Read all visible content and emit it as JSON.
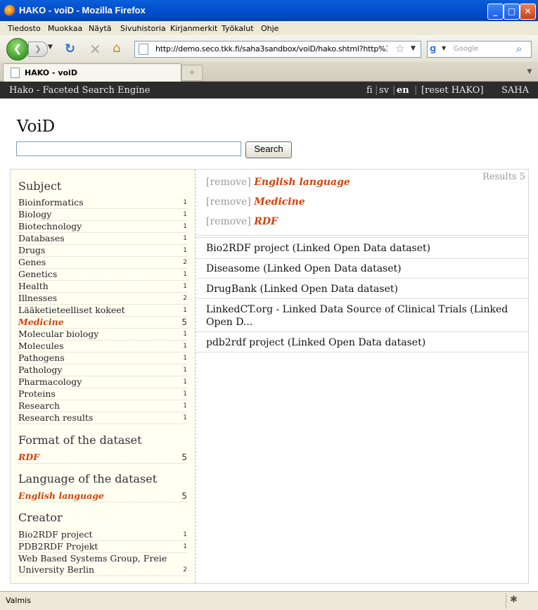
{
  "window": {
    "title": "HAKO - voiD - Mozilla Firefox"
  },
  "menu": [
    "Tiedosto",
    "Muokkaa",
    "Näytä",
    "Sivuhistoria",
    "Kirjanmerkit",
    "Työkalut",
    "Ohje"
  ],
  "nav": {
    "url": "http://demo.seco.tkk.fi/saha3sandbox/voiD/hako.shtml?http%3A%2",
    "search_placeholder": "Google"
  },
  "tab": {
    "label": "HAKO - voiD"
  },
  "app": {
    "brand": "Hako - Faceted Search Engine",
    "lang_fi": "fi",
    "lang_sv": "sv",
    "lang_en": "en",
    "reset": "[reset HAKO]",
    "saha": "SAHA"
  },
  "page": {
    "title": "VoiD",
    "search_button": "Search",
    "search_value": ""
  },
  "facets": {
    "subject": {
      "heading": "Subject",
      "items": [
        {
          "label": "Bioinformatics",
          "count": "1"
        },
        {
          "label": "Biology",
          "count": "1"
        },
        {
          "label": "Biotechnology",
          "count": "1"
        },
        {
          "label": "Databases",
          "count": "1"
        },
        {
          "label": "Drugs",
          "count": "1"
        },
        {
          "label": "Genes",
          "count": "2"
        },
        {
          "label": "Genetics",
          "count": "1"
        },
        {
          "label": "Health",
          "count": "1"
        },
        {
          "label": "Illnesses",
          "count": "2"
        },
        {
          "label": "Lääketieteelliset kokeet",
          "count": "1"
        },
        {
          "label": "Medicine",
          "count": "5"
        },
        {
          "label": "Molecular biology",
          "count": "1"
        },
        {
          "label": "Molecules",
          "count": "1"
        },
        {
          "label": "Pathogens",
          "count": "1"
        },
        {
          "label": "Pathology",
          "count": "1"
        },
        {
          "label": "Pharmacology",
          "count": "1"
        },
        {
          "label": "Proteins",
          "count": "1"
        },
        {
          "label": "Research",
          "count": "1"
        },
        {
          "label": "Research results",
          "count": "1"
        }
      ]
    },
    "format": {
      "heading": "Format of the dataset",
      "items": [
        {
          "label": "RDF",
          "count": "5"
        }
      ]
    },
    "language": {
      "heading": "Language of the dataset",
      "items": [
        {
          "label": "English language",
          "count": "5"
        }
      ]
    },
    "creator": {
      "heading": "Creator",
      "items": [
        {
          "label": "Bio2RDF project",
          "count": "1"
        },
        {
          "label": "PDB2RDF Projekt",
          "count": "1"
        },
        {
          "label": "Web Based Systems Group, Freie University Berlin",
          "count": "2"
        }
      ]
    }
  },
  "results": {
    "count_label": "Results 5",
    "remove_label": "[remove]",
    "active_filters": [
      "English language",
      "Medicine",
      "RDF"
    ],
    "items": [
      "Bio2RDF project (Linked Open Data dataset)",
      "Diseasome (Linked Open Data dataset)",
      "DrugBank (Linked Open Data dataset)",
      "LinkedCT.org - Linked Data Source of Clinical Trials (Linked Open D...",
      "pdb2rdf project (Linked Open Data dataset)"
    ]
  },
  "status": {
    "text": "Valmis"
  }
}
